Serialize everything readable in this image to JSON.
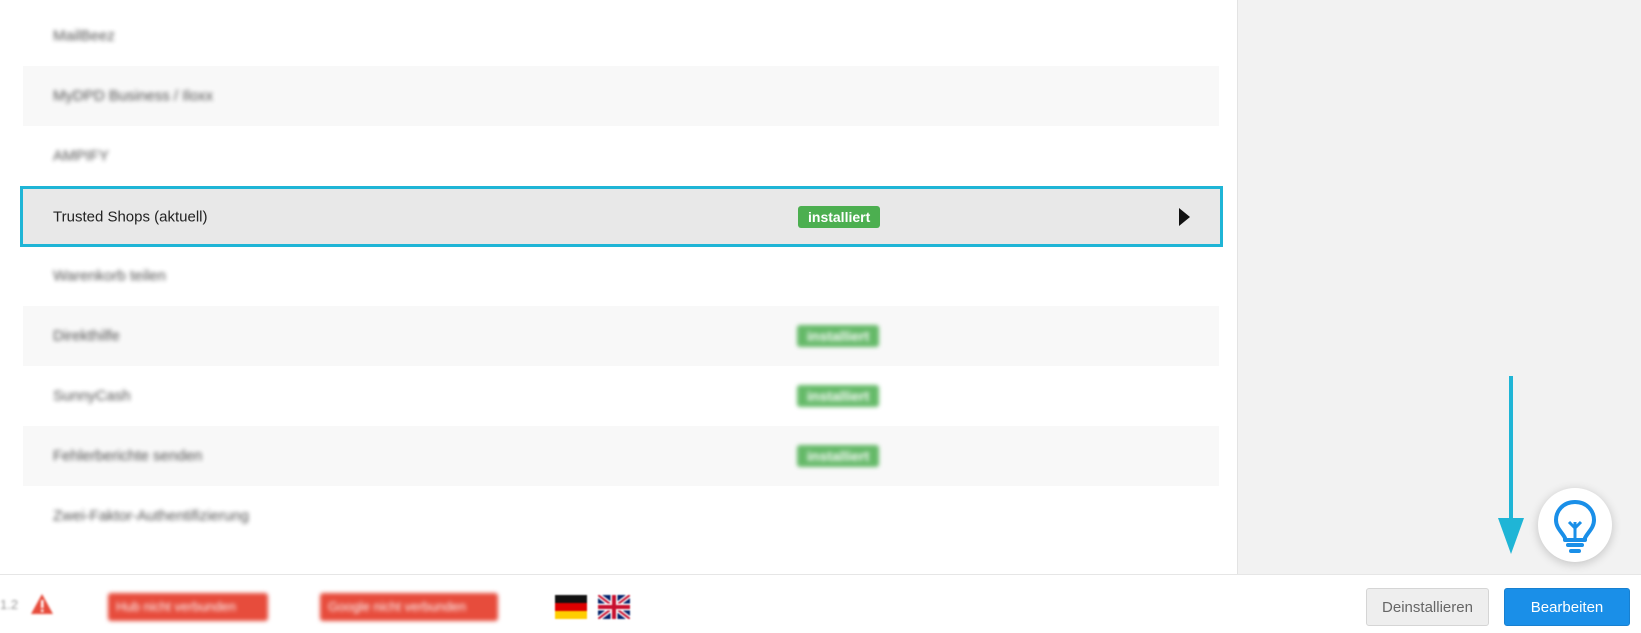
{
  "rows": [
    {
      "label": "MailBeez"
    },
    {
      "label": "MyDPD Business / Iloxx"
    },
    {
      "label": "AMPIFY"
    },
    {
      "label": "Trusted Shops (aktuell)",
      "badge": "installiert"
    },
    {
      "label": "Warenkorb teilen"
    },
    {
      "label": "Direkthilfe",
      "badge": "installiert"
    },
    {
      "label": "SunnyCash",
      "badge": "installiert"
    },
    {
      "label": "Fehlerberichte senden",
      "badge": "installiert"
    },
    {
      "label": "Zwei-Faktor-Authentifizierung"
    }
  ],
  "footer": {
    "version": "1.2",
    "hub_status": "Hub nicht verbunden",
    "google_status": "Google nicht verbunden",
    "uninstall_label": "Deinstallieren",
    "edit_label": "Bearbeiten"
  },
  "icons": {
    "warning": "warning-triangle-icon",
    "help": "lightbulb-icon",
    "caret": "caret-right-icon",
    "flag_de": "flag-germany-icon",
    "flag_en": "flag-uk-icon"
  },
  "colors": {
    "badge_green": "#4caf50",
    "selection_border": "#1fb5d6",
    "primary_button": "#1a8fe8",
    "status_red": "#e74c3c",
    "arrow": "#1fb5d6"
  }
}
